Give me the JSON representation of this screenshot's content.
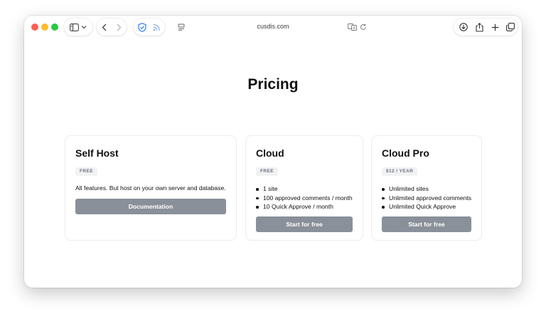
{
  "browser": {
    "address": "cusdis.com"
  },
  "page": {
    "title": "Pricing"
  },
  "plans": [
    {
      "name": "Self Host",
      "badge": "FREE",
      "description": "All features. But host on your own server and database.",
      "button": "Documentation"
    },
    {
      "name": "Cloud",
      "badge": "FREE",
      "features": [
        "1 site",
        "100 approved comments / month",
        "10 Quick Approve / month"
      ],
      "button": "Start for free"
    },
    {
      "name": "Cloud Pro",
      "badge": "$12 / YEAR",
      "features": [
        "Unlimited sites",
        "Unlimited approved comments",
        "Unlimited Quick Approve"
      ],
      "button": "Start for free"
    }
  ],
  "colors": {
    "button": "#8a9099",
    "badge_bg": "#f1f2f4",
    "shield_accent": "#2f7cf6"
  },
  "icons": [
    "sidebar-icon",
    "chevron-down-icon",
    "back-icon",
    "forward-icon",
    "shield-icon",
    "rss-icon",
    "page-settings-icon",
    "translate-icon",
    "reload-icon",
    "download-icon",
    "share-icon",
    "new-tab-icon",
    "tab-overview-icon"
  ]
}
